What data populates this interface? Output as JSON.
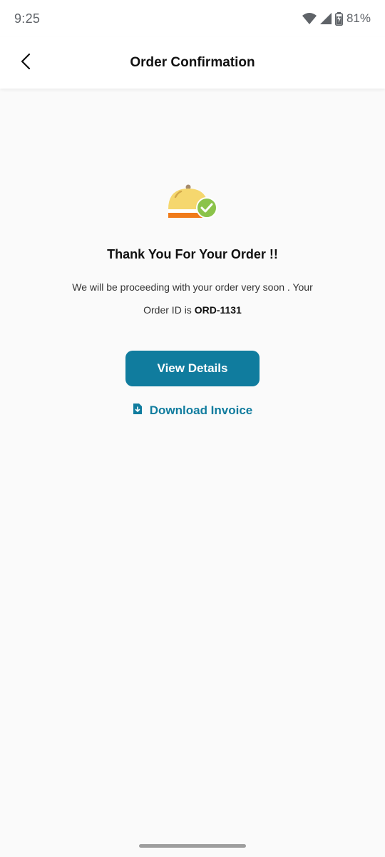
{
  "status_bar": {
    "time": "9:25",
    "battery": "81%",
    "icons": [
      "wifi-icon",
      "signal-icon",
      "battery-icon"
    ]
  },
  "app_bar": {
    "title": "Order Confirmation",
    "back_icon": "chevron-left-icon"
  },
  "confirmation": {
    "illustration": "food-cloche-check-icon",
    "title": "Thank You For Your Order !!",
    "message_line1": "We will be proceeding with your order very soon . Your",
    "message_prefix": "Order ID is",
    "order_id": "ORD-1131"
  },
  "actions": {
    "view_details_label": "View Details",
    "download_label": "Download Invoice",
    "download_icon": "file-download-icon"
  },
  "colors": {
    "accent": "#107c9e",
    "background": "#fafafa",
    "check_green": "#8bc34a",
    "cloche_yellow": "#f5d76e",
    "base_orange": "#f07b1a"
  }
}
